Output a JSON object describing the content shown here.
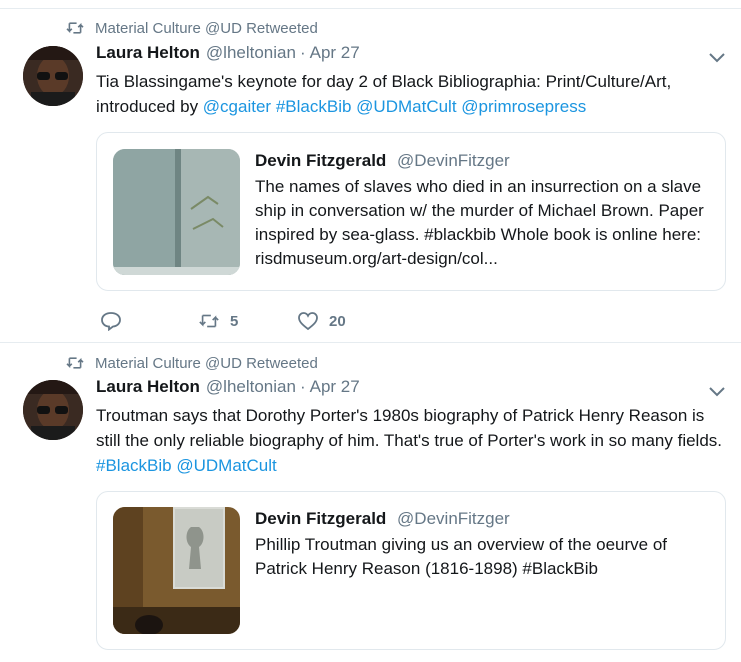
{
  "tweets": [
    {
      "retweet_label": "Material Culture @UD Retweeted",
      "author_name": "Laura Helton",
      "author_handle": "@lheltonian",
      "separator": "·",
      "date": "Apr 27",
      "text_segments": [
        {
          "t": "Tia Blassingame's keynote for day 2 of Black Bibliographia: Print/Culture/Art, introduced by ",
          "link": false
        },
        {
          "t": "@cgaiter",
          "link": true
        },
        {
          "t": " ",
          "link": false
        },
        {
          "t": "#BlackBib",
          "link": true
        },
        {
          "t": " ",
          "link": false
        },
        {
          "t": "@UDMatCult",
          "link": true
        },
        {
          "t": " ",
          "link": false
        },
        {
          "t": "@primrosepress",
          "link": true
        }
      ],
      "quote": {
        "name": "Devin Fitzgerald",
        "handle": "@DevinFitzger",
        "text": "The names of slaves who died in an insurrection on a slave ship in conversation w/ the murder of Michael Brown. Paper inspired by sea-glass. #blackbib Whole book is online here: risdmuseum.org/art-design/col..."
      },
      "actions": {
        "reply_count": "",
        "retweet_count": "5",
        "like_count": "20"
      }
    },
    {
      "retweet_label": "Material Culture @UD Retweeted",
      "author_name": "Laura Helton",
      "author_handle": "@lheltonian",
      "separator": "·",
      "date": "Apr 27",
      "text_segments": [
        {
          "t": "Troutman says that Dorothy Porter's 1980s biography of Patrick Henry Reason is still the only reliable biography of him. That's true of Porter's work in so many fields. ",
          "link": false
        },
        {
          "t": "#BlackBib",
          "link": true
        },
        {
          "t": " ",
          "link": false
        },
        {
          "t": "@UDMatCult",
          "link": true
        }
      ],
      "quote": {
        "name": "Devin Fitzgerald",
        "handle": "@DevinFitzger",
        "text": "Phillip Troutman giving us an overview of the oeurve of Patrick Henry Reason (1816-1898) #BlackBib"
      }
    }
  ],
  "colors": {
    "link": "#1b95e0",
    "secondary_text": "#657786",
    "divider": "#e6ecf0"
  }
}
